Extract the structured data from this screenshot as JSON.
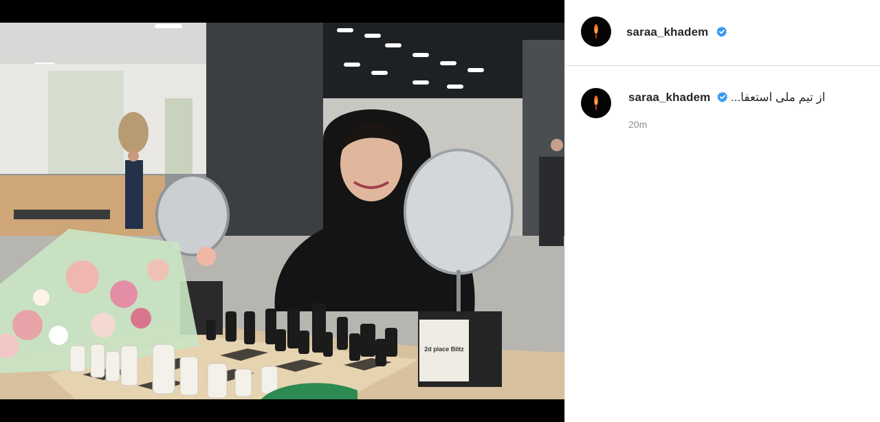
{
  "post": {
    "author": {
      "username": "saraa_khadem",
      "verified": true,
      "avatar_icon": "candle-avatar-icon"
    },
    "comment": {
      "username": "saraa_khadem",
      "text": "از تیم ملی استعفا...",
      "timestamp": "20m"
    },
    "media": {
      "trophy_plaque_line1": "2d place Blitz"
    }
  },
  "colors": {
    "verified_badge": "#3897f0",
    "text_primary": "#262626",
    "text_secondary": "#8e8e8e",
    "divider": "#dbdbdb"
  }
}
